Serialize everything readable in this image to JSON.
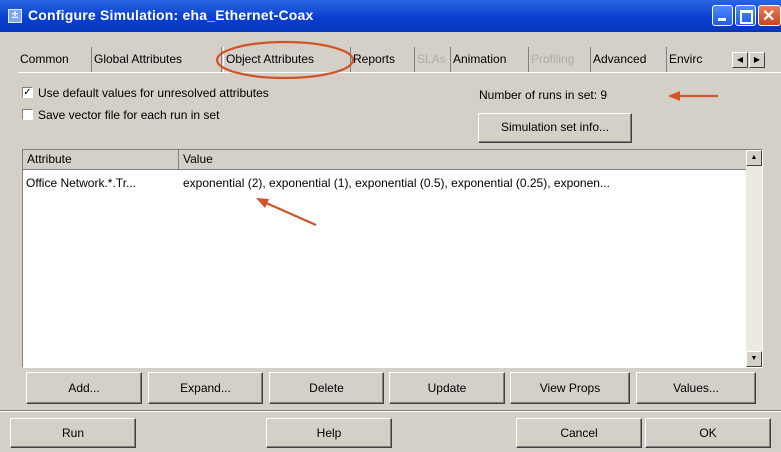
{
  "window": {
    "title": "Configure Simulation: eha_Ethernet-Coax",
    "sys_icon": "±"
  },
  "tabs": [
    {
      "label": "Common",
      "state": "normal"
    },
    {
      "label": "Global Attributes",
      "state": "normal"
    },
    {
      "label": "Object Attributes",
      "state": "active"
    },
    {
      "label": "Reports",
      "state": "normal"
    },
    {
      "label": "SLAs",
      "state": "disabled"
    },
    {
      "label": "Animation",
      "state": "normal"
    },
    {
      "label": "Profiling",
      "state": "disabled"
    },
    {
      "label": "Advanced",
      "state": "normal"
    },
    {
      "label": "Envirc",
      "state": "normal"
    }
  ],
  "options": {
    "use_defaults": {
      "label": "Use default values for unresolved attributes",
      "checked": true
    },
    "save_vector": {
      "label": "Save vector file for each run in set",
      "checked": false
    }
  },
  "runs": {
    "label": "Number of runs in set:",
    "value": "9"
  },
  "buttons": {
    "sim_set_info": "Simulation set info...",
    "add": "Add...",
    "expand": "Expand...",
    "delete": "Delete",
    "update": "Update",
    "view_props": "View Props",
    "values": "Values...",
    "run": "Run",
    "help": "Help",
    "cancel": "Cancel",
    "ok": "OK"
  },
  "table": {
    "headers": [
      "Attribute",
      "Value"
    ],
    "rows": [
      {
        "attribute": "Office Network.*.Tr...",
        "value": "exponential (2), exponential (1), exponential (0.5), exponential (0.25), exponen..."
      }
    ]
  },
  "colors": {
    "annotation": "#d2532a",
    "titlebar": "#0a3fd0",
    "dialog_bg": "#d4d0c8"
  }
}
